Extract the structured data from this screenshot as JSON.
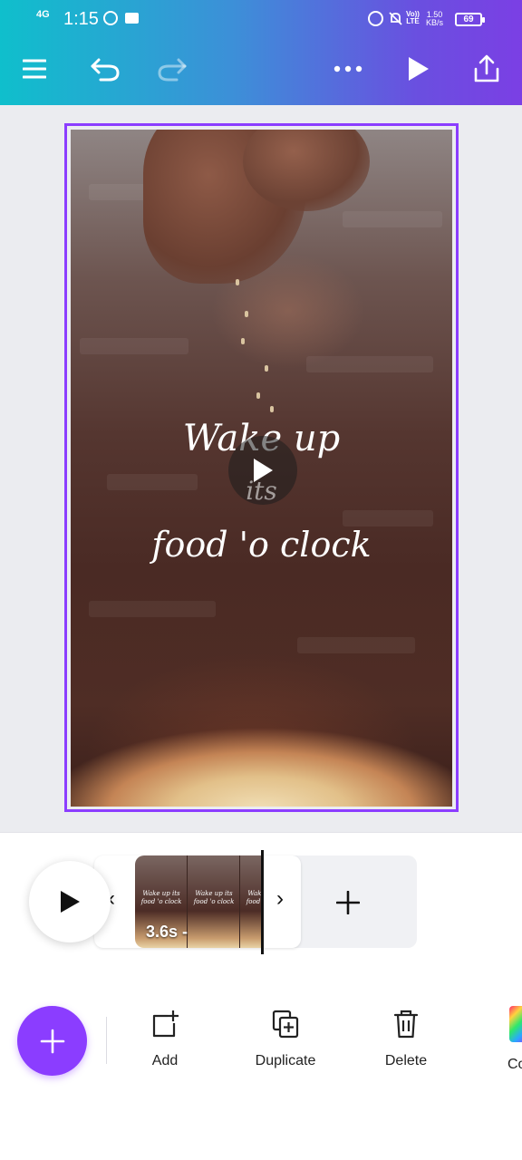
{
  "status_bar": {
    "network": "4G",
    "time": "1:15",
    "volte": "Vo))\nLTE",
    "speed": "1.50\nKB/s",
    "battery": "69"
  },
  "toolbar": {
    "menu": "menu-icon",
    "undo": "undo-icon",
    "redo": "redo-icon",
    "more": "more-icon",
    "present": "play-icon",
    "share": "share-icon"
  },
  "design": {
    "text_line1": "Wake up",
    "text_line2": "its",
    "text_line3": "food 'o clock"
  },
  "timeline": {
    "clip_duration": "3.6s -",
    "thumb_text": "Wake up its food 'o clock",
    "prev": "‹",
    "next": "›"
  },
  "bottom_toolbar": {
    "add_label": "Add",
    "duplicate_label": "Duplicate",
    "delete_label": "Delete",
    "color_label": "Co"
  },
  "colors": {
    "accent": "#8b3dff",
    "header_start": "#0fbfcc",
    "header_end": "#7b3fe4"
  }
}
